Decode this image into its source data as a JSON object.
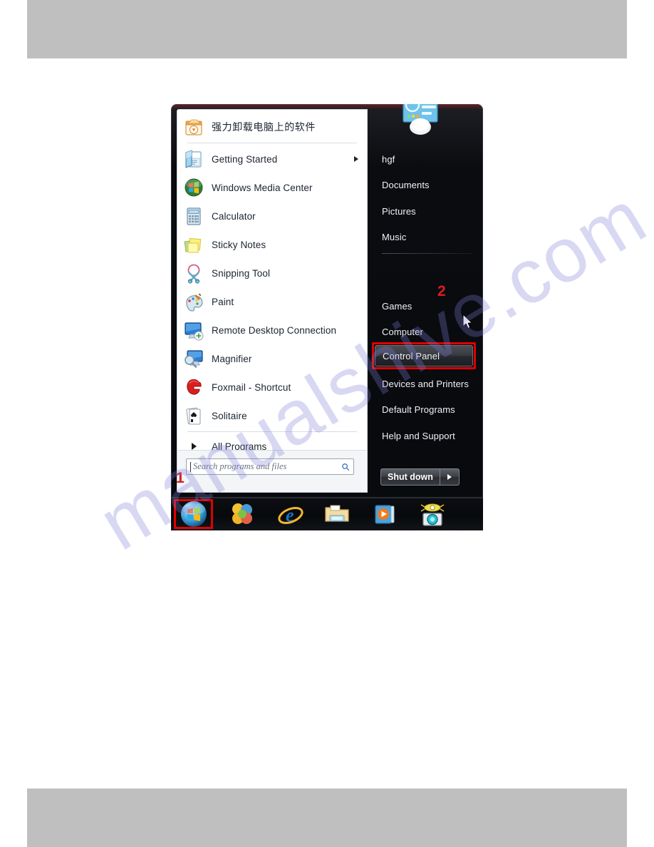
{
  "page": {
    "watermark": "manualshive.com",
    "accent_red": "#e00000",
    "taskbar_bg": "#07090c",
    "menu_bg": "#0b0c10",
    "pane_bg": "#ffffff"
  },
  "start_menu": {
    "programs": [
      {
        "label": "强力卸载电脑上的软件",
        "icon": "uninstaller-icon",
        "cjk": true,
        "submenu": false
      },
      {
        "label": "Getting Started",
        "icon": "getting-started-icon",
        "cjk": false,
        "submenu": true
      },
      {
        "label": "Windows Media Center",
        "icon": "windows-media-center-icon",
        "cjk": false,
        "submenu": false
      },
      {
        "label": "Calculator",
        "icon": "calculator-icon",
        "cjk": false,
        "submenu": false
      },
      {
        "label": "Sticky Notes",
        "icon": "sticky-notes-icon",
        "cjk": false,
        "submenu": false
      },
      {
        "label": "Snipping Tool",
        "icon": "snipping-tool-icon",
        "cjk": false,
        "submenu": false
      },
      {
        "label": "Paint",
        "icon": "paint-icon",
        "cjk": false,
        "submenu": false
      },
      {
        "label": "Remote Desktop Connection",
        "icon": "remote-desktop-icon",
        "cjk": false,
        "submenu": false
      },
      {
        "label": "Magnifier",
        "icon": "magnifier-icon",
        "cjk": false,
        "submenu": false
      },
      {
        "label": "Foxmail - Shortcut",
        "icon": "foxmail-icon",
        "cjk": false,
        "submenu": false
      },
      {
        "label": "Solitaire",
        "icon": "solitaire-icon",
        "cjk": false,
        "submenu": false
      }
    ],
    "all_programs_label": "All Programs",
    "search": {
      "placeholder": "Search programs and files",
      "value": "",
      "icon": "search-icon"
    },
    "places_top": [
      {
        "label": "hgf"
      },
      {
        "label": "Documents"
      },
      {
        "label": "Pictures"
      },
      {
        "label": "Music"
      }
    ],
    "places_bottom": [
      {
        "label": "Games",
        "highlighted": false
      },
      {
        "label": "Computer",
        "highlighted": false
      },
      {
        "label": "Control Panel",
        "highlighted": true
      },
      {
        "label": "Devices and Printers",
        "highlighted": false
      },
      {
        "label": "Default Programs",
        "highlighted": false
      },
      {
        "label": "Help and Support",
        "highlighted": false
      }
    ],
    "shutdown": {
      "label": "Shut down",
      "options_icon": "chevron-right-icon"
    },
    "avatar": {
      "name": "user-account-picture"
    }
  },
  "taskbar": {
    "items": [
      {
        "name": "start-orb",
        "label": "Start"
      },
      {
        "name": "pinwheel-app-icon",
        "label": ""
      },
      {
        "name": "internet-explorer-icon",
        "label": "Internet Explorer"
      },
      {
        "name": "windows-explorer-icon",
        "label": "Windows Explorer"
      },
      {
        "name": "windows-media-player-icon",
        "label": "Windows Media Player"
      },
      {
        "name": "webcam-app-icon",
        "label": ""
      }
    ]
  },
  "callouts": [
    {
      "number": "1",
      "target": "search-box"
    },
    {
      "number": "2",
      "target": "control-panel-item"
    }
  ]
}
